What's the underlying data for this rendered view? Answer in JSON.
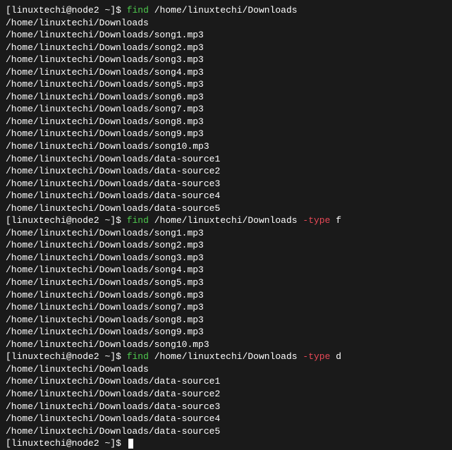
{
  "prompt": {
    "user": "linuxtechi",
    "host": "node2",
    "cwd": "~",
    "symbol": "$"
  },
  "commands": [
    {
      "cmd": "find",
      "args": "/home/linuxtechi/Downloads",
      "flag": "",
      "flagval": "",
      "output": [
        "/home/linuxtechi/Downloads",
        "/home/linuxtechi/Downloads/song1.mp3",
        "/home/linuxtechi/Downloads/song2.mp3",
        "/home/linuxtechi/Downloads/song3.mp3",
        "/home/linuxtechi/Downloads/song4.mp3",
        "/home/linuxtechi/Downloads/song5.mp3",
        "/home/linuxtechi/Downloads/song6.mp3",
        "/home/linuxtechi/Downloads/song7.mp3",
        "/home/linuxtechi/Downloads/song8.mp3",
        "/home/linuxtechi/Downloads/song9.mp3",
        "/home/linuxtechi/Downloads/song10.mp3",
        "/home/linuxtechi/Downloads/data-source1",
        "/home/linuxtechi/Downloads/data-source2",
        "/home/linuxtechi/Downloads/data-source3",
        "/home/linuxtechi/Downloads/data-source4",
        "/home/linuxtechi/Downloads/data-source5"
      ]
    },
    {
      "cmd": "find",
      "args": "/home/linuxtechi/Downloads",
      "flag": "-type",
      "flagval": "f",
      "output": [
        "/home/linuxtechi/Downloads/song1.mp3",
        "/home/linuxtechi/Downloads/song2.mp3",
        "/home/linuxtechi/Downloads/song3.mp3",
        "/home/linuxtechi/Downloads/song4.mp3",
        "/home/linuxtechi/Downloads/song5.mp3",
        "/home/linuxtechi/Downloads/song6.mp3",
        "/home/linuxtechi/Downloads/song7.mp3",
        "/home/linuxtechi/Downloads/song8.mp3",
        "/home/linuxtechi/Downloads/song9.mp3",
        "/home/linuxtechi/Downloads/song10.mp3"
      ]
    },
    {
      "cmd": "find",
      "args": "/home/linuxtechi/Downloads",
      "flag": "-type",
      "flagval": "d",
      "output": [
        "/home/linuxtechi/Downloads",
        "/home/linuxtechi/Downloads/data-source1",
        "/home/linuxtechi/Downloads/data-source2",
        "/home/linuxtechi/Downloads/data-source3",
        "/home/linuxtechi/Downloads/data-source4",
        "/home/linuxtechi/Downloads/data-source5"
      ]
    }
  ]
}
